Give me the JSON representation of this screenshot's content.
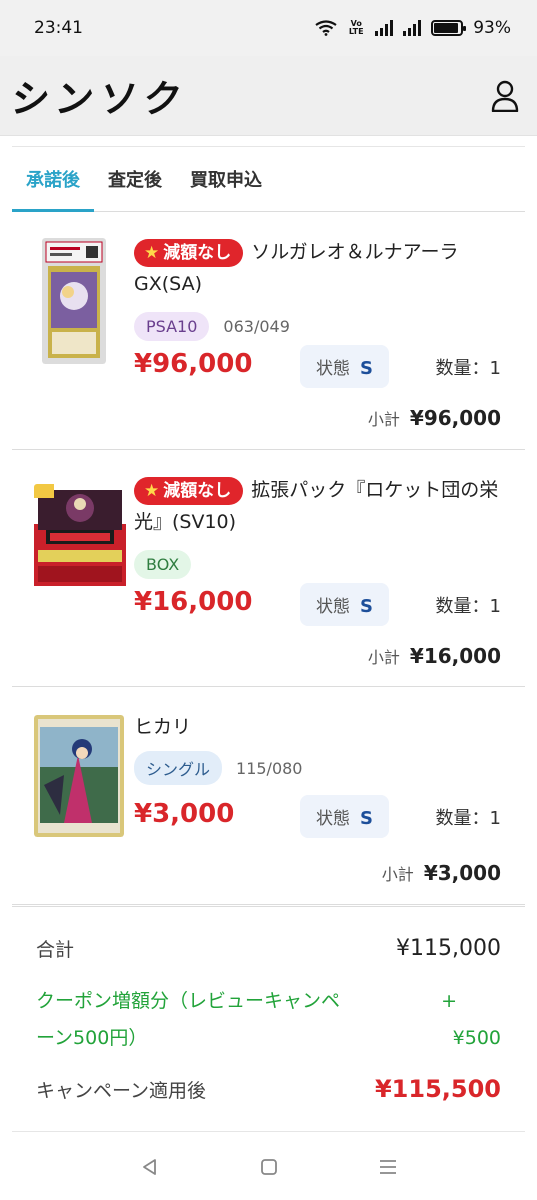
{
  "status": {
    "time": "23:41",
    "battery": "93%",
    "volte": "Vo LTE"
  },
  "header": {
    "logo": "シンソク"
  },
  "tabs": [
    {
      "label": "承諾後",
      "active": true
    },
    {
      "label": "査定後",
      "active": false
    },
    {
      "label": "買取申込",
      "active": false
    }
  ],
  "items": [
    {
      "badge": "減額なし",
      "name": "ソルガレオ＆ルナアーラGX(SA)",
      "tag": "PSA10",
      "card_no": "063/049",
      "price": "¥96,000",
      "cond_label": "状態",
      "cond_value": "S",
      "qty": "数量：1",
      "subtotal_label": "小計",
      "subtotal": "¥96,000"
    },
    {
      "badge": "減額なし",
      "name": "拡張パック『ロケット団の栄光』(SV10)",
      "tag": "BOX",
      "card_no": "",
      "price": "¥16,000",
      "cond_label": "状態",
      "cond_value": "S",
      "qty": "数量：1",
      "subtotal_label": "小計",
      "subtotal": "¥16,000"
    },
    {
      "badge": "",
      "name": "ヒカリ",
      "tag": "シングル",
      "card_no": "115/080",
      "price": "¥3,000",
      "cond_label": "状態",
      "cond_value": "S",
      "qty": "数量：1",
      "subtotal_label": "小計",
      "subtotal": "¥3,000"
    }
  ],
  "totals": {
    "total_label": "合計",
    "total_value": "¥115,000",
    "coupon_label_1": "クーポン増額分（レビューキャンペ",
    "coupon_label_2": "ーン500円）",
    "coupon_plus": "+",
    "coupon_value": "¥500",
    "final_label": "キャンペーン適用後",
    "final_value": "¥115,500"
  },
  "colors": {
    "accent": "#2aa3c8",
    "price_red": "#d9262a",
    "coupon_green": "#22a33a"
  }
}
